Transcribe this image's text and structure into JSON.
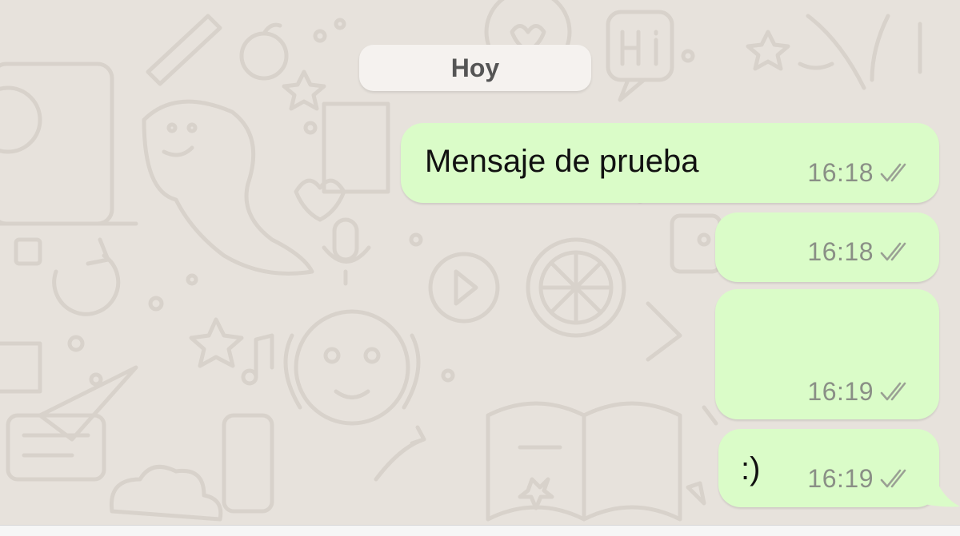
{
  "chat": {
    "date_separator": "Hoy",
    "messages": [
      {
        "text": "Mensaje de prueba",
        "time": "16:18",
        "status": "read"
      },
      {
        "text": "",
        "time": "16:18",
        "status": "read"
      },
      {
        "text": "",
        "time": "16:19",
        "status": "read"
      },
      {
        "text": ":)",
        "time": "16:19",
        "status": "read"
      }
    ]
  },
  "icons": {
    "double_check": "double-check-icon",
    "wallpaper": "whatsapp-doodle-pattern"
  },
  "colors": {
    "wallpaper_bg": "#e7e2dc",
    "outgoing_bubble": "#dafcc8",
    "date_pill": "#f5f2ef",
    "timestamp": "#8a8f86",
    "text": "#111111"
  }
}
